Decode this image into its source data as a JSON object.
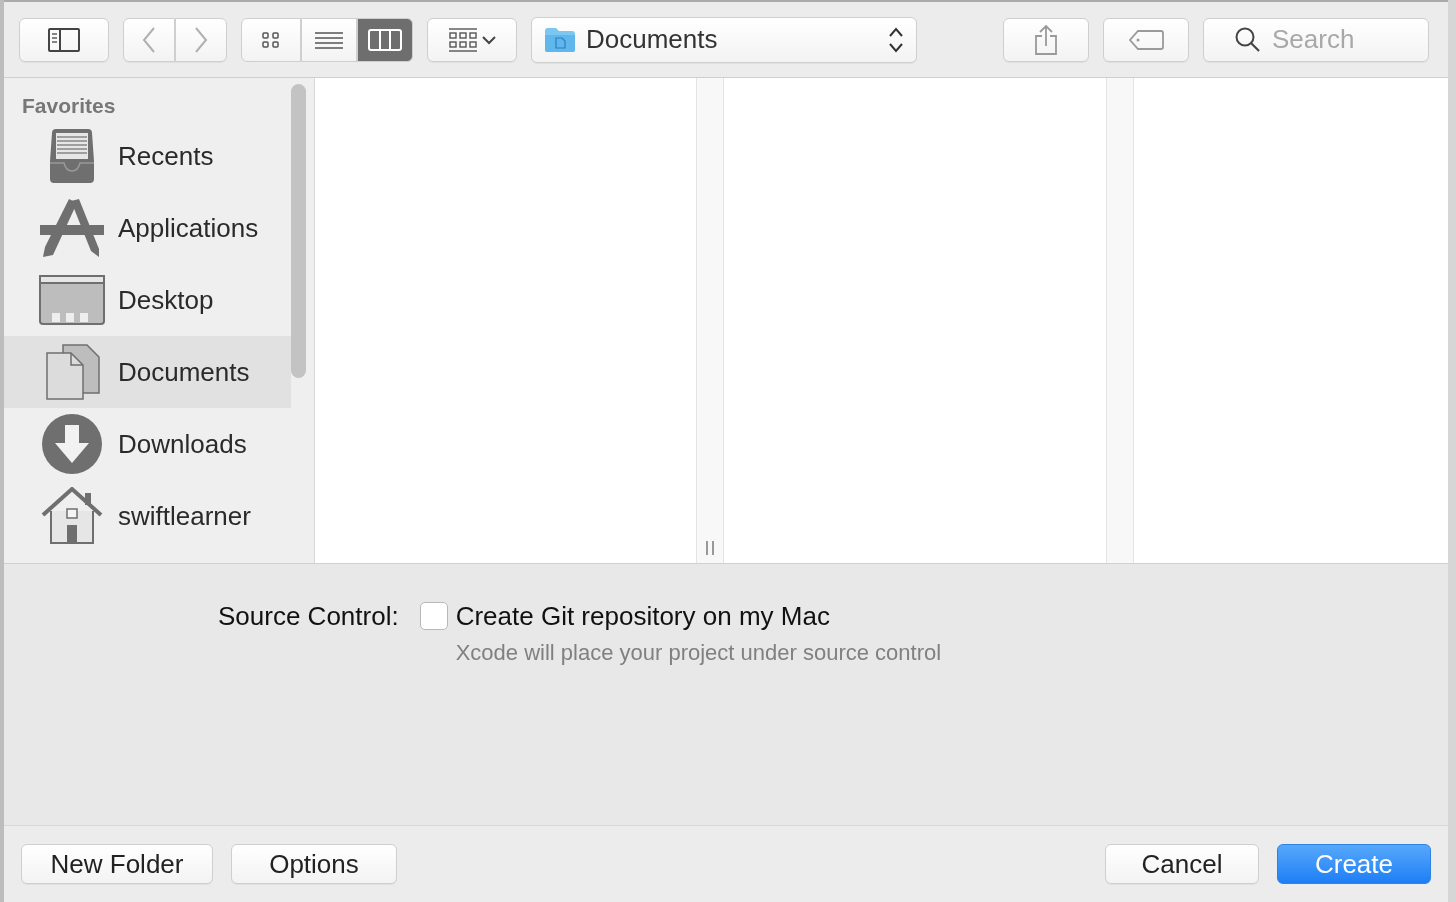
{
  "toolbar": {
    "view_modes": [
      {
        "kind": "icons",
        "selected": false
      },
      {
        "kind": "list",
        "selected": false
      },
      {
        "kind": "columns",
        "selected": true
      }
    ],
    "location": "Documents",
    "search": {
      "placeholder": "Search"
    }
  },
  "sidebar": {
    "heading": "Favorites",
    "items": [
      {
        "kind": "recents",
        "label": "Recents",
        "selected": false
      },
      {
        "kind": "applications",
        "label": "Applications",
        "selected": false
      },
      {
        "kind": "desktop",
        "label": "Desktop",
        "selected": false
      },
      {
        "kind": "documents",
        "label": "Documents",
        "selected": true
      },
      {
        "kind": "downloads",
        "label": "Downloads",
        "selected": false
      },
      {
        "kind": "home",
        "label": "swiftlearner",
        "selected": false
      }
    ]
  },
  "options": {
    "label": "Source Control:",
    "checkbox": {
      "label": "Create Git repository on my Mac",
      "checked": false
    },
    "hint": "Xcode will place your project under source control"
  },
  "footer": {
    "left_buttons": [
      "New Folder",
      "Options"
    ],
    "cancel": "Cancel",
    "confirm": "Create"
  }
}
